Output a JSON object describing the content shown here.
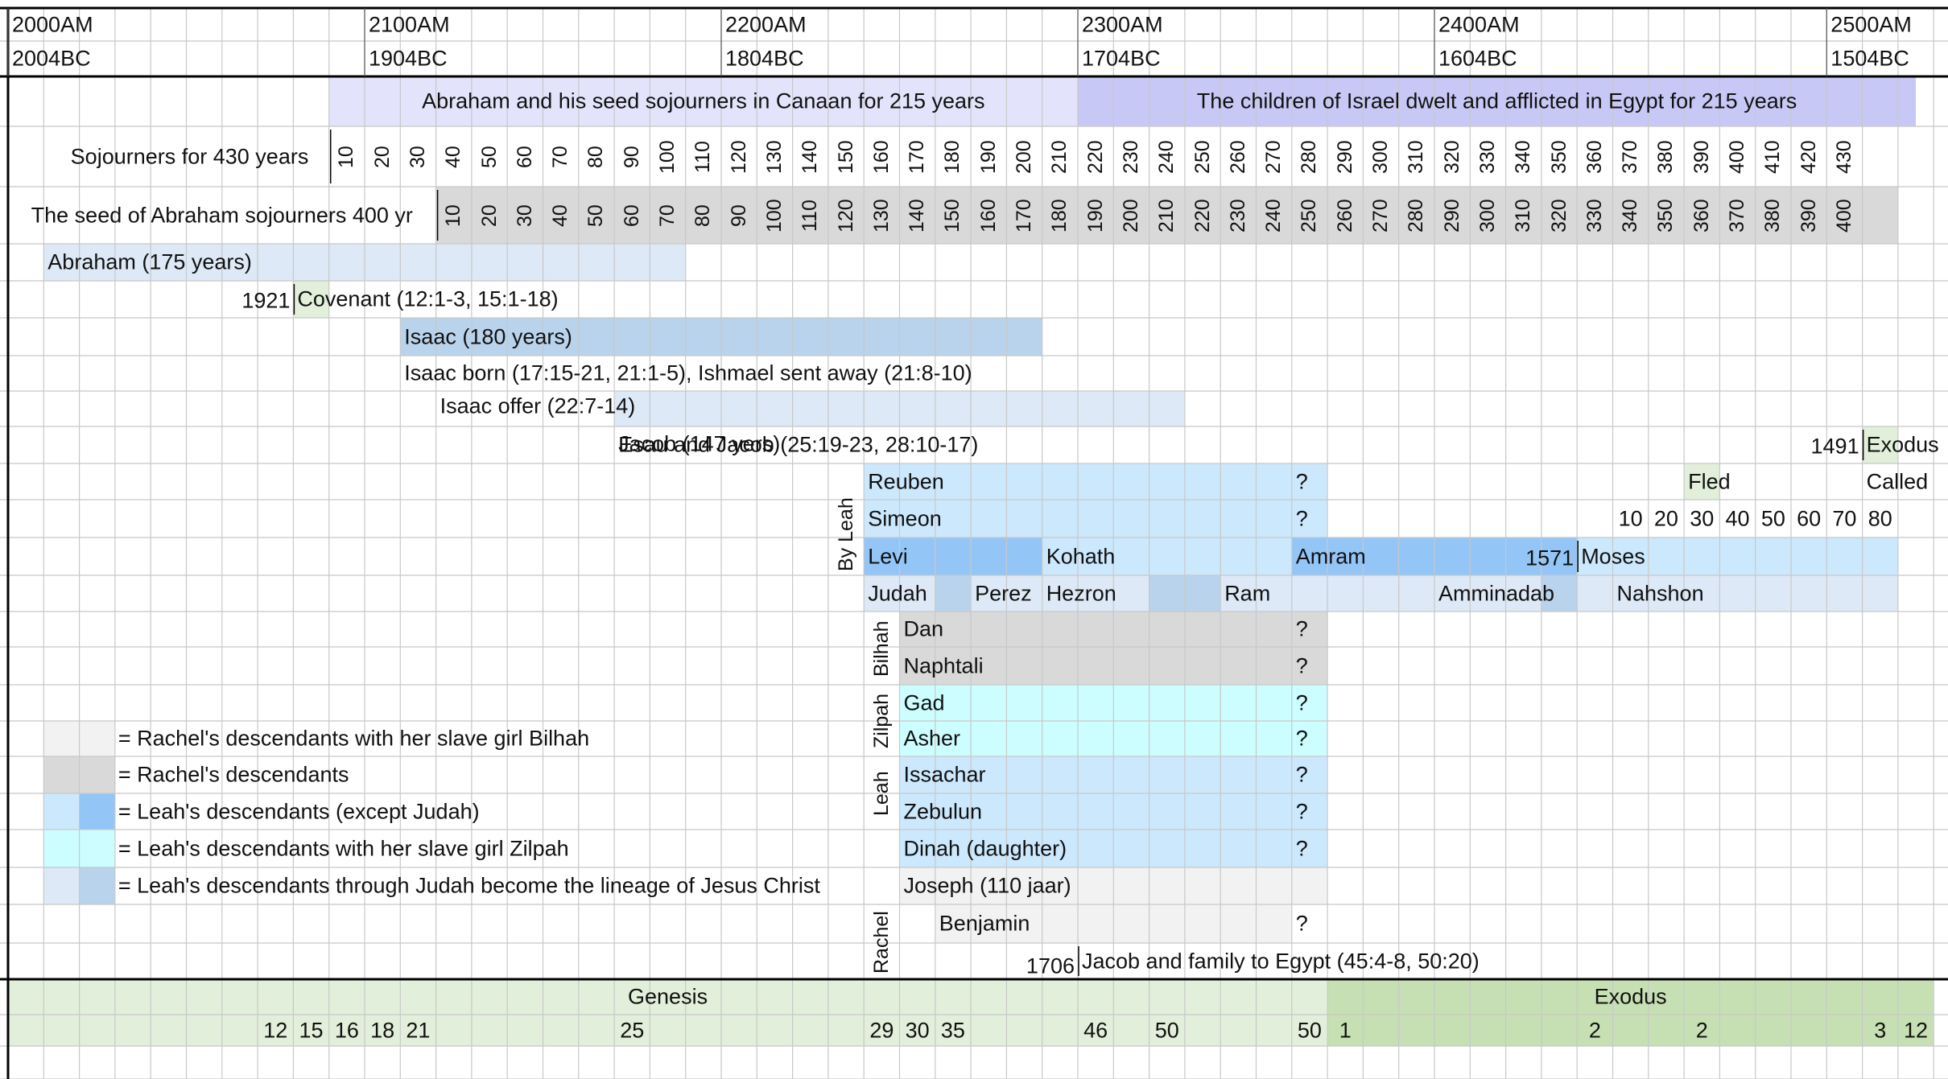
{
  "header": {
    "years": [
      {
        "am": "2000AM",
        "bc": "2004BC"
      },
      {
        "am": "2100AM",
        "bc": "1904BC"
      },
      {
        "am": "2200AM",
        "bc": "1804BC"
      },
      {
        "am": "2300AM",
        "bc": "1704BC"
      },
      {
        "am": "2400AM",
        "bc": "1604BC"
      },
      {
        "am": "2500AM",
        "bc": "1504BC"
      }
    ]
  },
  "eras": {
    "canaan": "Abraham and his seed sojourners in Canaan for 215 years",
    "egypt": "The children of Israel dwelt and afflicted in Egypt for 215 years"
  },
  "sojourn430": {
    "label": "Sojourners for 430 years",
    "ticks": [
      "10",
      "20",
      "30",
      "40",
      "50",
      "60",
      "70",
      "80",
      "90",
      "100",
      "110",
      "120",
      "130",
      "140",
      "150",
      "160",
      "170",
      "180",
      "190",
      "200",
      "210",
      "220",
      "230",
      "240",
      "250",
      "260",
      "270",
      "280",
      "290",
      "300",
      "310",
      "320",
      "330",
      "340",
      "350",
      "360",
      "370",
      "380",
      "390",
      "400",
      "410",
      "420",
      "430"
    ]
  },
  "sojourn400": {
    "label": "The seed of Abraham sojourners 400 yr",
    "ticks": [
      "10",
      "20",
      "30",
      "40",
      "50",
      "60",
      "70",
      "80",
      "90",
      "100",
      "110",
      "120",
      "130",
      "140",
      "150",
      "160",
      "170",
      "180",
      "190",
      "200",
      "210",
      "220",
      "230",
      "240",
      "250",
      "260",
      "270",
      "280",
      "290",
      "300",
      "310",
      "320",
      "330",
      "340",
      "350",
      "360",
      "370",
      "380",
      "390",
      "400"
    ]
  },
  "events": {
    "abraham": "Abraham (175 years)",
    "covenant_year": "1921",
    "covenant": "Covenant (12:1-3, 15:1-18)",
    "isaac": "Isaac (180 years)",
    "isaac_born": "Isaac born (17:15-21, 21:1-5), Ishmael sent away (21:8-10)",
    "isaac_offer": "Isaac offer (22:7-14)",
    "jacob": "Jacob (147 yers)",
    "esau_jacob": "Esau and Jacob (25:19-23, 28:10-17)",
    "exodus_year": "1491",
    "exodus": "Exodus",
    "fled": "Fled",
    "called": "Called",
    "moses_ages": [
      "10",
      "20",
      "30",
      "40",
      "50",
      "60",
      "70",
      "80"
    ],
    "moses_year": "1571",
    "moses": "Moses",
    "egypt_year": "1706",
    "jacob_to_egypt": "Jacob and family to Egypt (45:4-8, 50:20)"
  },
  "groups": {
    "leah1": "By Leah",
    "bilhah": "Bilhah",
    "zilpah": "Zilpah",
    "leah2": "Leah",
    "rachel": "Rachel"
  },
  "tribes": {
    "reuben": "Reuben",
    "simeon": "Simeon",
    "levi": "Levi",
    "kohath": "Kohath",
    "amram": "Amram",
    "judah": "Judah",
    "perez": "Perez",
    "hezron": "Hezron",
    "ram": "Ram",
    "amminadab": "Amminadab",
    "nahshon": "Nahshon",
    "dan": "Dan",
    "naphtali": "Naphtali",
    "gad": "Gad",
    "asher": "Asher",
    "issachar": "Issachar",
    "zebulun": "Zebulun",
    "dinah": "Dinah (daughter)",
    "joseph": "Joseph (110 jaar)",
    "benjamin": "Benjamin",
    "unknown": "?"
  },
  "legend": [
    {
      "text": "= Rachel's descendants with her slave girl Bilhah",
      "colors": [
        "#f2f2f2",
        "#f2f2f2"
      ]
    },
    {
      "text": "= Rachel's descendants",
      "colors": [
        "#d9d9d9",
        "#d9d9d9"
      ]
    },
    {
      "text": "= Leah's descendants (except Judah)",
      "colors": [
        "#cce8fd",
        "#93c6f7"
      ]
    },
    {
      "text": "= Leah's descendants with her slave girl Zilpah",
      "colors": [
        "#ccfeff",
        "#ccfeff"
      ]
    },
    {
      "text": "= Leah's descendants through Judah become the lineage of Jesus Christ",
      "colors": [
        "#dde9f6",
        "#b9d3ec"
      ]
    }
  ],
  "books": {
    "genesis": "Genesis",
    "exodus": "Exodus",
    "genesis_chapters": [
      "12",
      "15",
      "16",
      "18",
      "21",
      "25",
      "29",
      "30",
      "35",
      "46",
      "50",
      "50"
    ],
    "exodus_chapters": [
      "1",
      "2",
      "2",
      "3",
      "12"
    ]
  },
  "colors": {
    "grid": "#c8c8c8",
    "canaan_band": "#e3e3fb",
    "egypt_band": "#c8c8f6",
    "tick_band": "#d9d9d9",
    "abraham": "#dde9f6",
    "isaac": "#b9d3ec",
    "leah": "#cce8fd",
    "levi": "#93c6f7",
    "bilhah": "#d9d9d9",
    "zilpah": "#ccfeff",
    "rachel": "#f2f2f2",
    "green_light": "#e2efda",
    "green_dark": "#c6e0b4"
  }
}
